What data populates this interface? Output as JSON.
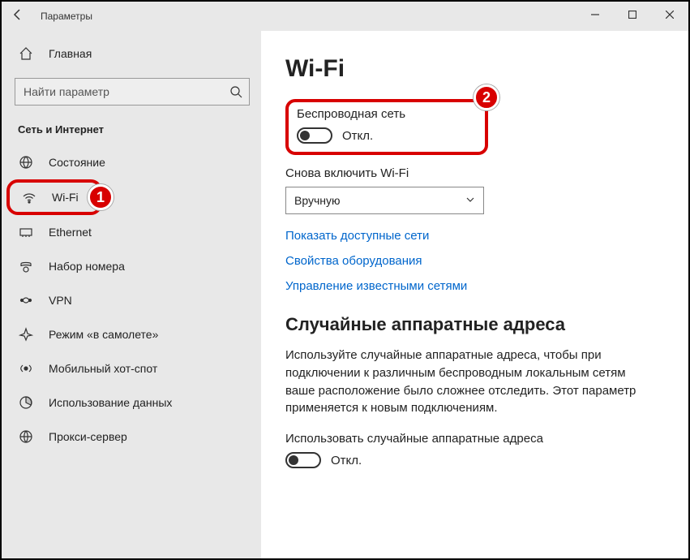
{
  "window": {
    "title": "Параметры"
  },
  "sidebar": {
    "home": "Главная",
    "search_placeholder": "Найти параметр",
    "section": "Сеть и Интернет",
    "items": [
      {
        "label": "Состояние"
      },
      {
        "label": "Wi-Fi"
      },
      {
        "label": "Ethernet"
      },
      {
        "label": "Набор номера"
      },
      {
        "label": "VPN"
      },
      {
        "label": "Режим «в самолете»"
      },
      {
        "label": "Мобильный хот-спот"
      },
      {
        "label": "Использование данных"
      },
      {
        "label": "Прокси-сервер"
      }
    ]
  },
  "page": {
    "title": "Wi-Fi",
    "wireless_label": "Беспроводная сеть",
    "wireless_state": "Откл.",
    "reenable_label": "Снова включить Wi-Fi",
    "reenable_value": "Вручную",
    "link_show_networks": "Показать доступные сети",
    "link_hw_props": "Свойства оборудования",
    "link_known_nets": "Управление известными сетями",
    "random_hw_title": "Случайные аппаратные адреса",
    "random_hw_desc": "Используйте случайные аппаратные адреса, чтобы при подключении к различным беспроводным локальным сетям ваше расположение было сложнее отследить. Этот параметр применяется к новым подключениям.",
    "random_hw_toggle_label": "Использовать случайные аппаратные адреса",
    "random_hw_state": "Откл."
  },
  "badges": {
    "one": "1",
    "two": "2"
  }
}
